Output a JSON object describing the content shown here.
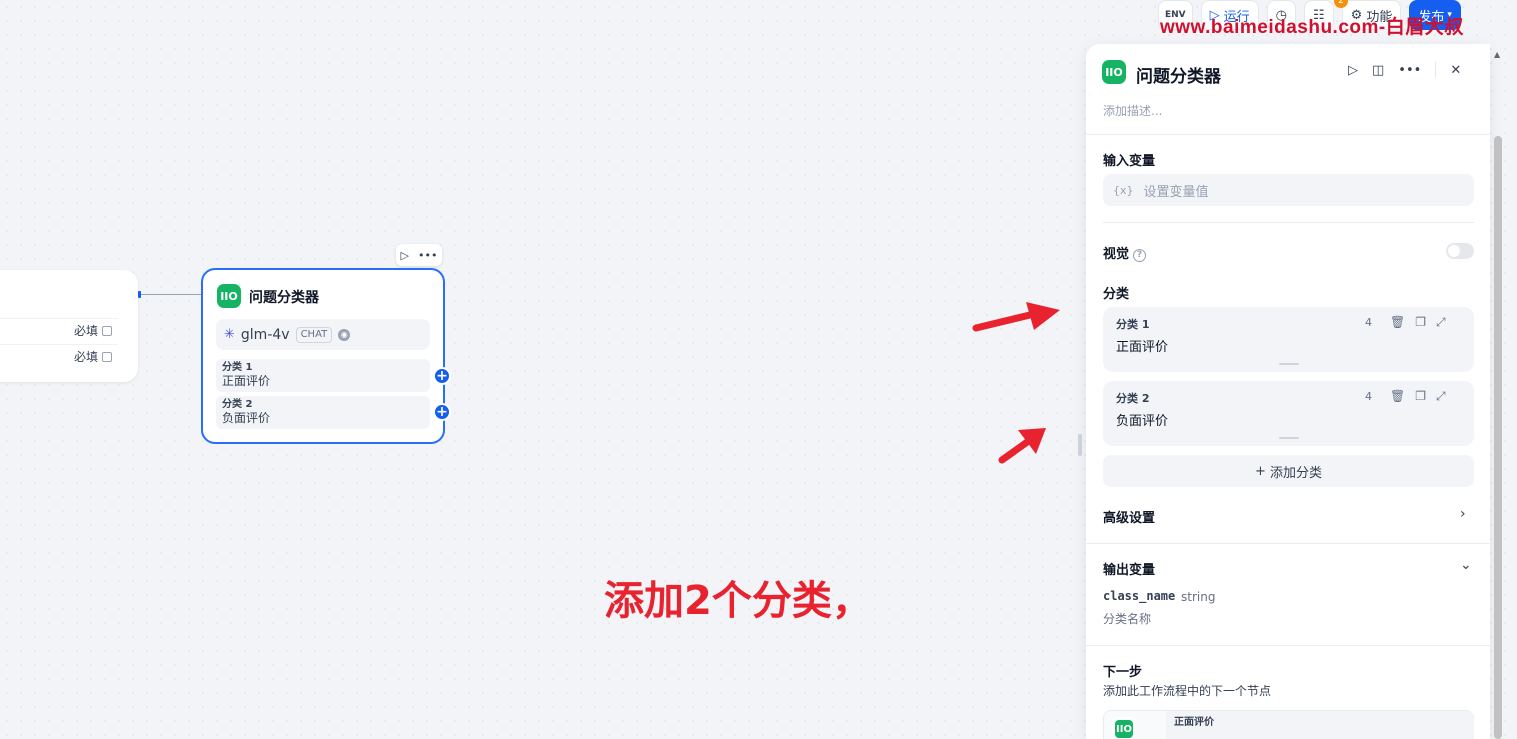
{
  "topbar": {
    "env_label": "ENV",
    "run_label": "运行",
    "features_label": "功能",
    "publish_label": "发布",
    "notification_count": "2"
  },
  "watermark": "www.baimeidashu.com-白眉大叔",
  "left_node": {
    "rows": [
      "必填",
      "必填"
    ]
  },
  "node": {
    "title": "问题分类器",
    "icon_text": "IIO",
    "model": "glm-4v",
    "model_tag": "CHAT",
    "classes": [
      {
        "title": "分类 1",
        "value": "正面评价"
      },
      {
        "title": "分类 2",
        "value": "负面评价"
      }
    ]
  },
  "annotation": "添加2个分类，",
  "panel": {
    "title": "问题分类器",
    "description_placeholder": "添加描述...",
    "input_vars_label": "输入变量",
    "input_prefix": "{x}",
    "input_placeholder": "设置变量值",
    "vision_label": "视觉",
    "classes_label": "分类",
    "classes": [
      {
        "title": "分类 1",
        "count": "4",
        "value": "正面评价"
      },
      {
        "title": "分类 2",
        "count": "4",
        "value": "负面评价"
      }
    ],
    "add_class_label": "添加分类",
    "advanced_label": "高级设置",
    "output_label": "输出变量",
    "output_var_name": "class_name",
    "output_var_type": "string",
    "output_var_desc": "分类名称",
    "next_step_label": "下一步",
    "next_step_desc": "添加此工作流程中的下一个节点",
    "next_branch": "正面评价"
  },
  "colors": {
    "accent": "#155eef",
    "node_green": "#16b364",
    "annotation_red": "#e8222e"
  }
}
